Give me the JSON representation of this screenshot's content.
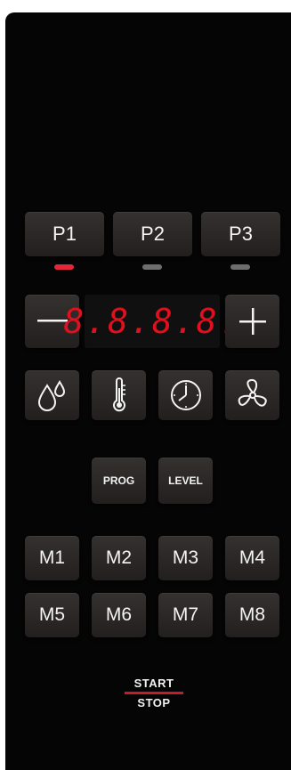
{
  "programs": [
    {
      "label": "P1",
      "indicator_color": "#e5253a"
    },
    {
      "label": "P2",
      "indicator_color": "#6e6e6e"
    },
    {
      "label": "P3",
      "indicator_color": "#6e6e6e"
    }
  ],
  "display": {
    "value": "8.8.8.8."
  },
  "controls": {
    "minus_icon": "minus-icon",
    "plus_icon": "plus-icon",
    "humidity_icon": "humidity-drops-icon",
    "temperature_icon": "thermometer-icon",
    "timer_icon": "clock-icon",
    "fan_icon": "fan-icon"
  },
  "functions": {
    "prog_label": "PROG",
    "level_label": "LEVEL"
  },
  "memory": [
    "M1",
    "M2",
    "M3",
    "M4",
    "M5",
    "M6",
    "M7",
    "M8"
  ],
  "start_stop": {
    "start_label": "START",
    "stop_label": "STOP",
    "divider_color": "#c41c2b"
  }
}
